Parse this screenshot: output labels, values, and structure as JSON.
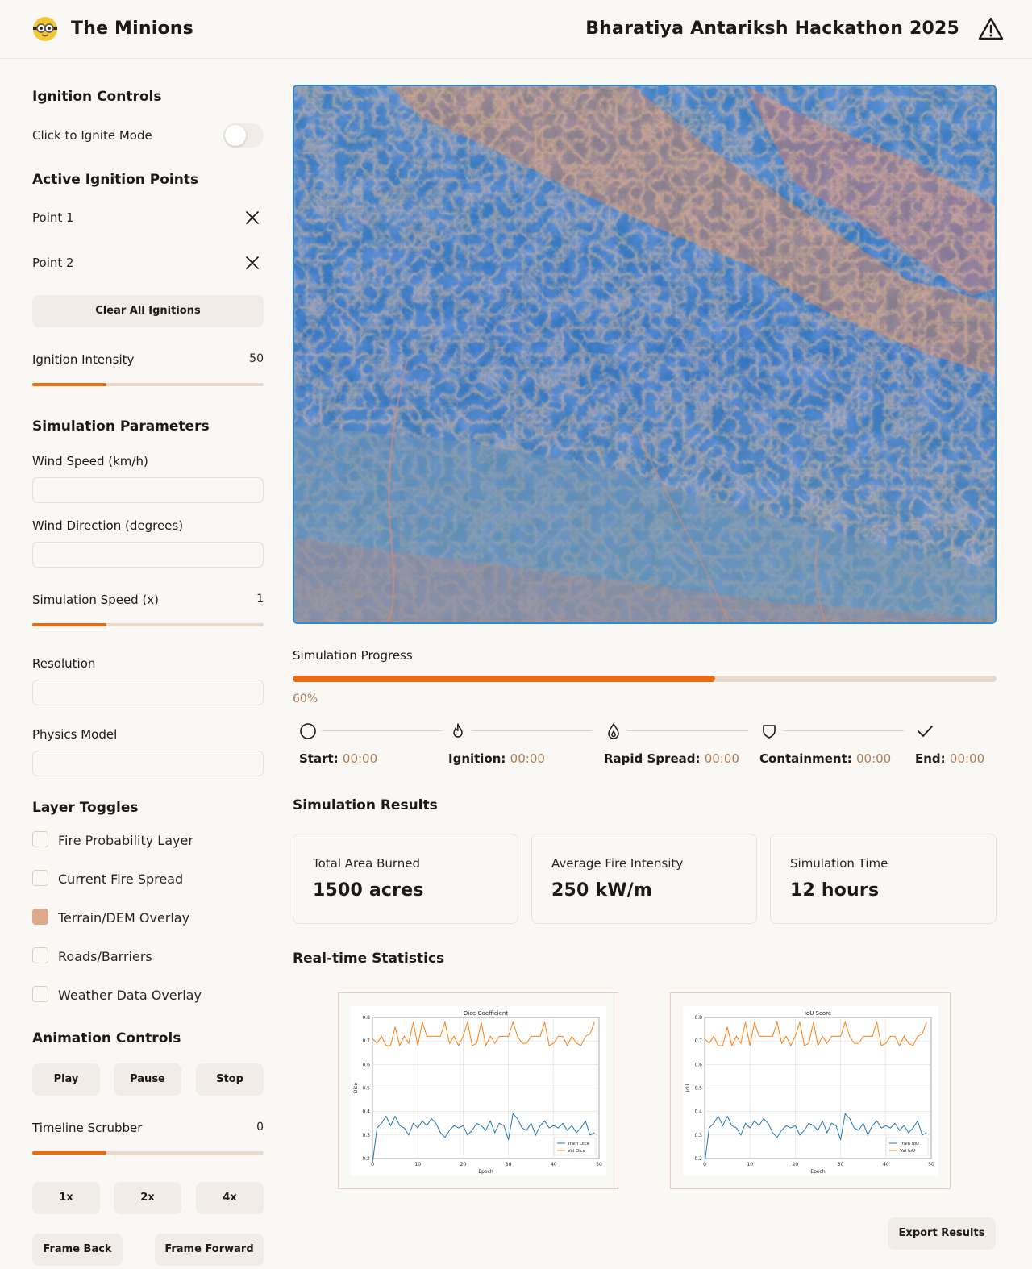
{
  "header": {
    "app_title": "The Minions",
    "event_title": "Bharatiya Antariksh Hackathon 2025",
    "logo_icon": "minion-icon",
    "alert_icon": "warning-triangle-icon"
  },
  "ignition": {
    "heading": "Ignition Controls",
    "mode_label": "Click to Ignite Mode",
    "mode_on": false,
    "points_heading": "Active Ignition Points",
    "points": [
      {
        "label": "Point 1"
      },
      {
        "label": "Point 2"
      }
    ],
    "clear_button": "Clear All Ignitions",
    "intensity_label": "Ignition Intensity",
    "intensity_value": "50",
    "intensity_fill": 0.32
  },
  "params": {
    "heading": "Simulation Parameters",
    "wind_speed_label": "Wind Speed (km/h)",
    "wind_dir_label": "Wind Direction (degrees)",
    "sim_speed_label": "Simulation Speed (x)",
    "sim_speed_value": "1",
    "sim_speed_fill": 0.32,
    "resolution_label": "Resolution",
    "physics_label": "Physics Model"
  },
  "layers": {
    "heading": "Layer Toggles",
    "items": [
      {
        "label": "Fire Probability Layer",
        "checked": false
      },
      {
        "label": "Current Fire Spread",
        "checked": false
      },
      {
        "label": "Terrain/DEM Overlay",
        "checked": true
      },
      {
        "label": "Roads/Barriers",
        "checked": false
      },
      {
        "label": "Weather Data Overlay",
        "checked": false
      }
    ]
  },
  "animation": {
    "heading": "Animation Controls",
    "play": "Play",
    "pause": "Pause",
    "stop": "Stop",
    "scrubber_label": "Timeline Scrubber",
    "scrubber_value": "0",
    "scrubber_fill": 0.32,
    "speed_1x": "1x",
    "speed_2x": "2x",
    "speed_4x": "4x",
    "frame_back": "Frame Back",
    "frame_forward": "Frame Forward"
  },
  "progress": {
    "label": "Simulation Progress",
    "percent_text": "60%",
    "fraction": 0.6
  },
  "timeline": [
    {
      "label": "Start:",
      "time": "00:00",
      "icon": "circle-icon"
    },
    {
      "label": "Ignition:",
      "time": "00:00",
      "icon": "flame-icon"
    },
    {
      "label": "Rapid Spread:",
      "time": "00:00",
      "icon": "flame-outline-icon"
    },
    {
      "label": "Containment:",
      "time": "00:00",
      "icon": "shield-icon"
    },
    {
      "label": "End:",
      "time": "00:00",
      "icon": "check-icon"
    }
  ],
  "results": {
    "heading": "Simulation Results",
    "cards": [
      {
        "title": "Total Area Burned",
        "value": "1500 acres"
      },
      {
        "title": "Average Fire Intensity",
        "value": "250 kW/m"
      },
      {
        "title": "Simulation Time",
        "value": "12 hours"
      }
    ]
  },
  "stats": {
    "heading": "Real-time Statistics"
  },
  "export_button": "Export Results",
  "colors": {
    "accent": "#ea6a12",
    "train_line": "#1f77b4",
    "val_line": "#ff7f0e"
  },
  "chart_data": [
    {
      "type": "line",
      "title": "Dice Coefficient",
      "xlabel": "Epoch",
      "ylabel": "Dice",
      "xlim": [
        0,
        50
      ],
      "ylim": [
        0.2,
        0.8
      ],
      "xticks": [
        "0",
        "10",
        "20",
        "30",
        "40",
        "50"
      ],
      "yticks": [
        "0.2",
        "0.3",
        "0.4",
        "0.5",
        "0.6",
        "0.7",
        "0.8"
      ],
      "grid": true,
      "legend": "bottom-right",
      "x": [
        0,
        1,
        2,
        3,
        4,
        5,
        6,
        7,
        8,
        9,
        10,
        11,
        12,
        13,
        14,
        15,
        16,
        17,
        18,
        19,
        20,
        21,
        22,
        23,
        24,
        25,
        26,
        27,
        28,
        29,
        30,
        31,
        32,
        33,
        34,
        35,
        36,
        37,
        38,
        39,
        40,
        41,
        42,
        43,
        44,
        45,
        46,
        47,
        48,
        49
      ],
      "series": [
        {
          "name": "Train Dice",
          "values": [
            0.18,
            0.33,
            0.35,
            0.38,
            0.34,
            0.38,
            0.34,
            0.33,
            0.3,
            0.35,
            0.33,
            0.36,
            0.34,
            0.37,
            0.35,
            0.31,
            0.29,
            0.32,
            0.34,
            0.33,
            0.34,
            0.3,
            0.32,
            0.35,
            0.34,
            0.32,
            0.36,
            0.31,
            0.35,
            0.34,
            0.28,
            0.39,
            0.37,
            0.33,
            0.32,
            0.35,
            0.3,
            0.34,
            0.36,
            0.33,
            0.34,
            0.33,
            0.35,
            0.32,
            0.34,
            0.31,
            0.33,
            0.36,
            0.3,
            0.31
          ]
        },
        {
          "name": "Val Dice",
          "values": [
            0.71,
            0.69,
            0.72,
            0.68,
            0.68,
            0.76,
            0.68,
            0.72,
            0.69,
            0.78,
            0.68,
            0.78,
            0.72,
            0.72,
            0.72,
            0.72,
            0.78,
            0.69,
            0.72,
            0.68,
            0.72,
            0.78,
            0.68,
            0.69,
            0.78,
            0.68,
            0.72,
            0.69,
            0.72,
            0.72,
            0.72,
            0.78,
            0.72,
            0.69,
            0.69,
            0.72,
            0.72,
            0.72,
            0.78,
            0.68,
            0.69,
            0.72,
            0.72,
            0.68,
            0.72,
            0.69,
            0.68,
            0.72,
            0.73,
            0.78
          ]
        }
      ]
    },
    {
      "type": "line",
      "title": "IoU Score",
      "xlabel": "Epoch",
      "ylabel": "IoU",
      "xlim": [
        0,
        50
      ],
      "ylim": [
        0.2,
        0.8
      ],
      "xticks": [
        "0",
        "10",
        "20",
        "30",
        "40",
        "50"
      ],
      "yticks": [
        "0.2",
        "0.3",
        "0.4",
        "0.5",
        "0.6",
        "0.7",
        "0.8"
      ],
      "grid": true,
      "legend": "bottom-right",
      "x": [
        0,
        1,
        2,
        3,
        4,
        5,
        6,
        7,
        8,
        9,
        10,
        11,
        12,
        13,
        14,
        15,
        16,
        17,
        18,
        19,
        20,
        21,
        22,
        23,
        24,
        25,
        26,
        27,
        28,
        29,
        30,
        31,
        32,
        33,
        34,
        35,
        36,
        37,
        38,
        39,
        40,
        41,
        42,
        43,
        44,
        45,
        46,
        47,
        48,
        49
      ],
      "series": [
        {
          "name": "Train IoU",
          "values": [
            0.18,
            0.33,
            0.35,
            0.38,
            0.34,
            0.38,
            0.34,
            0.33,
            0.3,
            0.35,
            0.33,
            0.36,
            0.34,
            0.37,
            0.35,
            0.31,
            0.29,
            0.32,
            0.34,
            0.33,
            0.34,
            0.3,
            0.32,
            0.35,
            0.34,
            0.32,
            0.36,
            0.31,
            0.35,
            0.34,
            0.28,
            0.39,
            0.37,
            0.33,
            0.32,
            0.35,
            0.3,
            0.34,
            0.36,
            0.33,
            0.34,
            0.33,
            0.35,
            0.32,
            0.34,
            0.31,
            0.33,
            0.36,
            0.3,
            0.31
          ]
        },
        {
          "name": "Val IoU",
          "values": [
            0.71,
            0.69,
            0.72,
            0.68,
            0.68,
            0.76,
            0.68,
            0.72,
            0.69,
            0.78,
            0.68,
            0.78,
            0.72,
            0.72,
            0.72,
            0.72,
            0.78,
            0.69,
            0.72,
            0.68,
            0.72,
            0.78,
            0.68,
            0.69,
            0.78,
            0.68,
            0.72,
            0.69,
            0.72,
            0.72,
            0.72,
            0.78,
            0.72,
            0.69,
            0.69,
            0.72,
            0.72,
            0.72,
            0.78,
            0.68,
            0.69,
            0.72,
            0.72,
            0.68,
            0.72,
            0.69,
            0.68,
            0.72,
            0.73,
            0.78
          ]
        }
      ]
    }
  ]
}
